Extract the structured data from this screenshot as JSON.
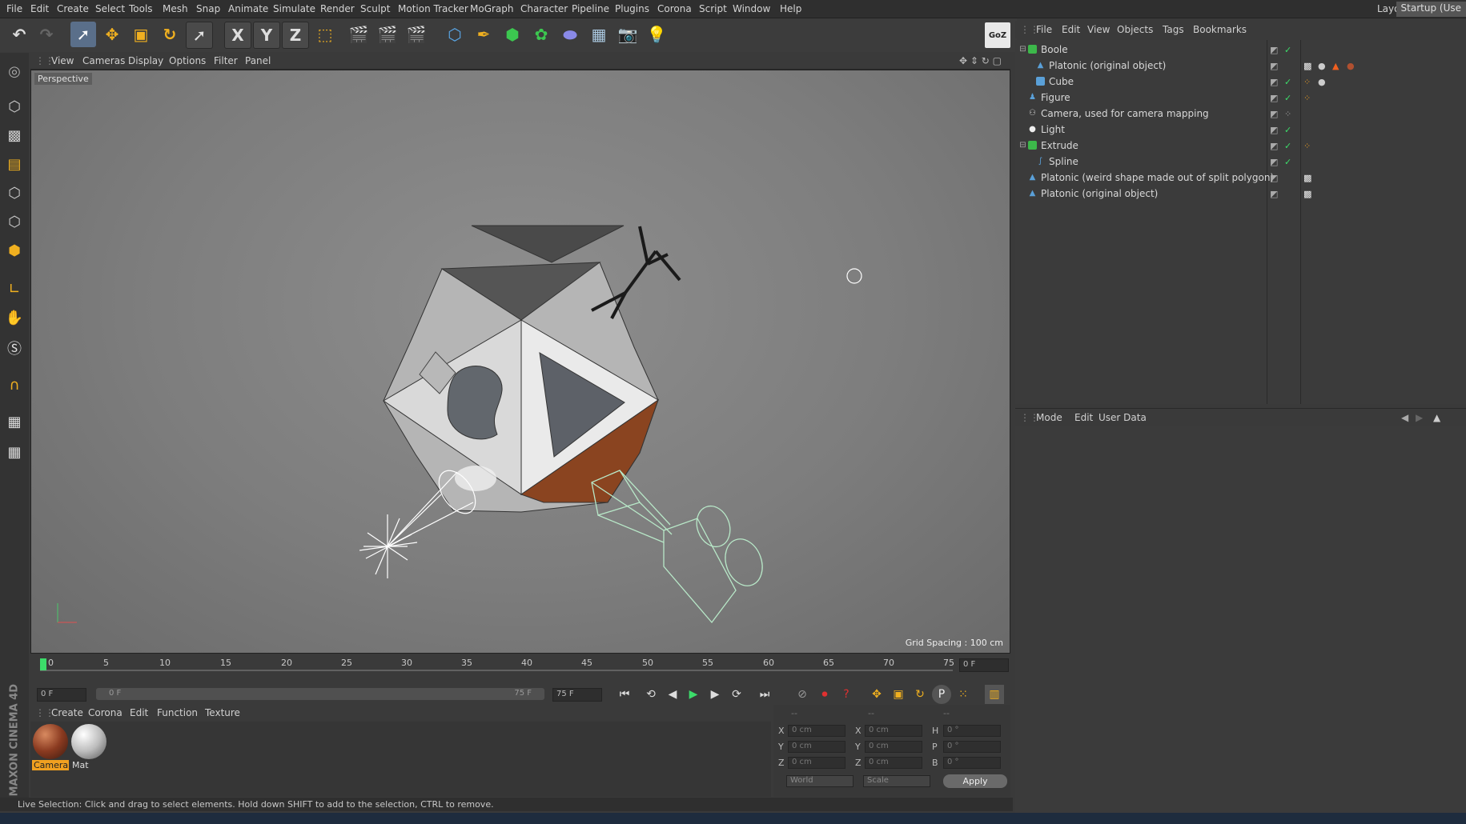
{
  "menubar": {
    "items": [
      "File",
      "Edit",
      "Create",
      "Select",
      "Tools",
      "Mesh",
      "Snap",
      "Animate",
      "Simulate",
      "Render",
      "Sculpt",
      "Motion Tracker",
      "MoGraph",
      "Character",
      "Pipeline",
      "Plugins",
      "Corona",
      "Script",
      "Window",
      "Help"
    ],
    "layout_label": "Layout:",
    "layout_value": "Startup (Use"
  },
  "toolbar": {
    "axis_x": "X",
    "axis_y": "Y",
    "axis_z": "Z",
    "goz": "GoZ"
  },
  "viewport": {
    "menu": [
      "View",
      "Cameras",
      "Display",
      "Options",
      "Filter",
      "Panel"
    ],
    "view_name": "Perspective",
    "grid_spacing": "Grid Spacing : 100 cm"
  },
  "timeline": {
    "ticks": [
      "0",
      "5",
      "10",
      "15",
      "20",
      "25",
      "30",
      "35",
      "40",
      "45",
      "50",
      "55",
      "60",
      "65",
      "70",
      "75"
    ],
    "current_frame": "0 F",
    "start_field": "0 F",
    "range_start": "0 F",
    "range_end": "75 F",
    "end_field": "75 F"
  },
  "materials": {
    "menu": [
      "Create",
      "Corona",
      "Edit",
      "Function",
      "Texture"
    ],
    "items": [
      {
        "label": "Camera",
        "color": "#8a3a20"
      },
      {
        "label": "Mat",
        "color": "#bdbdbd"
      }
    ]
  },
  "coords": {
    "headers": [
      "--",
      "--",
      "--"
    ],
    "pos_x": "0 cm",
    "pos_y": "0 cm",
    "pos_z": "0 cm",
    "size_x": "0 cm",
    "size_y": "0 cm",
    "size_z": "0 cm",
    "rot_h": "0 °",
    "rot_p": "0 °",
    "rot_b": "0 °",
    "world": "World",
    "scale": "Scale",
    "apply": "Apply"
  },
  "status": {
    "text": "Live Selection: Click and drag to select elements. Hold down SHIFT to add to the selection, CTRL to remove."
  },
  "object_manager": {
    "menu": [
      "File",
      "Edit",
      "View",
      "Objects",
      "Tags",
      "Bookmarks"
    ],
    "objects": [
      {
        "name": "Boole",
        "indent": 0,
        "color": "#3cb84a",
        "check": "✓"
      },
      {
        "name": "Platonic (original object)",
        "indent": 1,
        "color": "#5aa0d8",
        "check": ""
      },
      {
        "name": "Cube",
        "indent": 1,
        "color": "#5aa0d8",
        "check": "✓"
      },
      {
        "name": "Figure",
        "indent": 0,
        "color": "#5aa0d8",
        "check": "✓"
      },
      {
        "name": "Camera, used for camera mapping",
        "indent": 0,
        "color": "#cccccc",
        "check": ""
      },
      {
        "name": "Light",
        "indent": 0,
        "color": "#eeeeee",
        "check": "✓"
      },
      {
        "name": "Extrude",
        "indent": 0,
        "color": "#3cb84a",
        "check": "✓"
      },
      {
        "name": "Spline",
        "indent": 1,
        "color": "#5aa0d8",
        "check": "✓"
      },
      {
        "name": "Platonic (weird shape made out of split polygon)",
        "indent": 0,
        "color": "#5aa0d8",
        "check": ""
      },
      {
        "name": "Platonic (original object)",
        "indent": 0,
        "color": "#5aa0d8",
        "check": ""
      }
    ]
  },
  "attribute_manager": {
    "menu": [
      "Mode",
      "Edit",
      "User Data"
    ]
  },
  "branding": "MAXON CINEMA 4D"
}
